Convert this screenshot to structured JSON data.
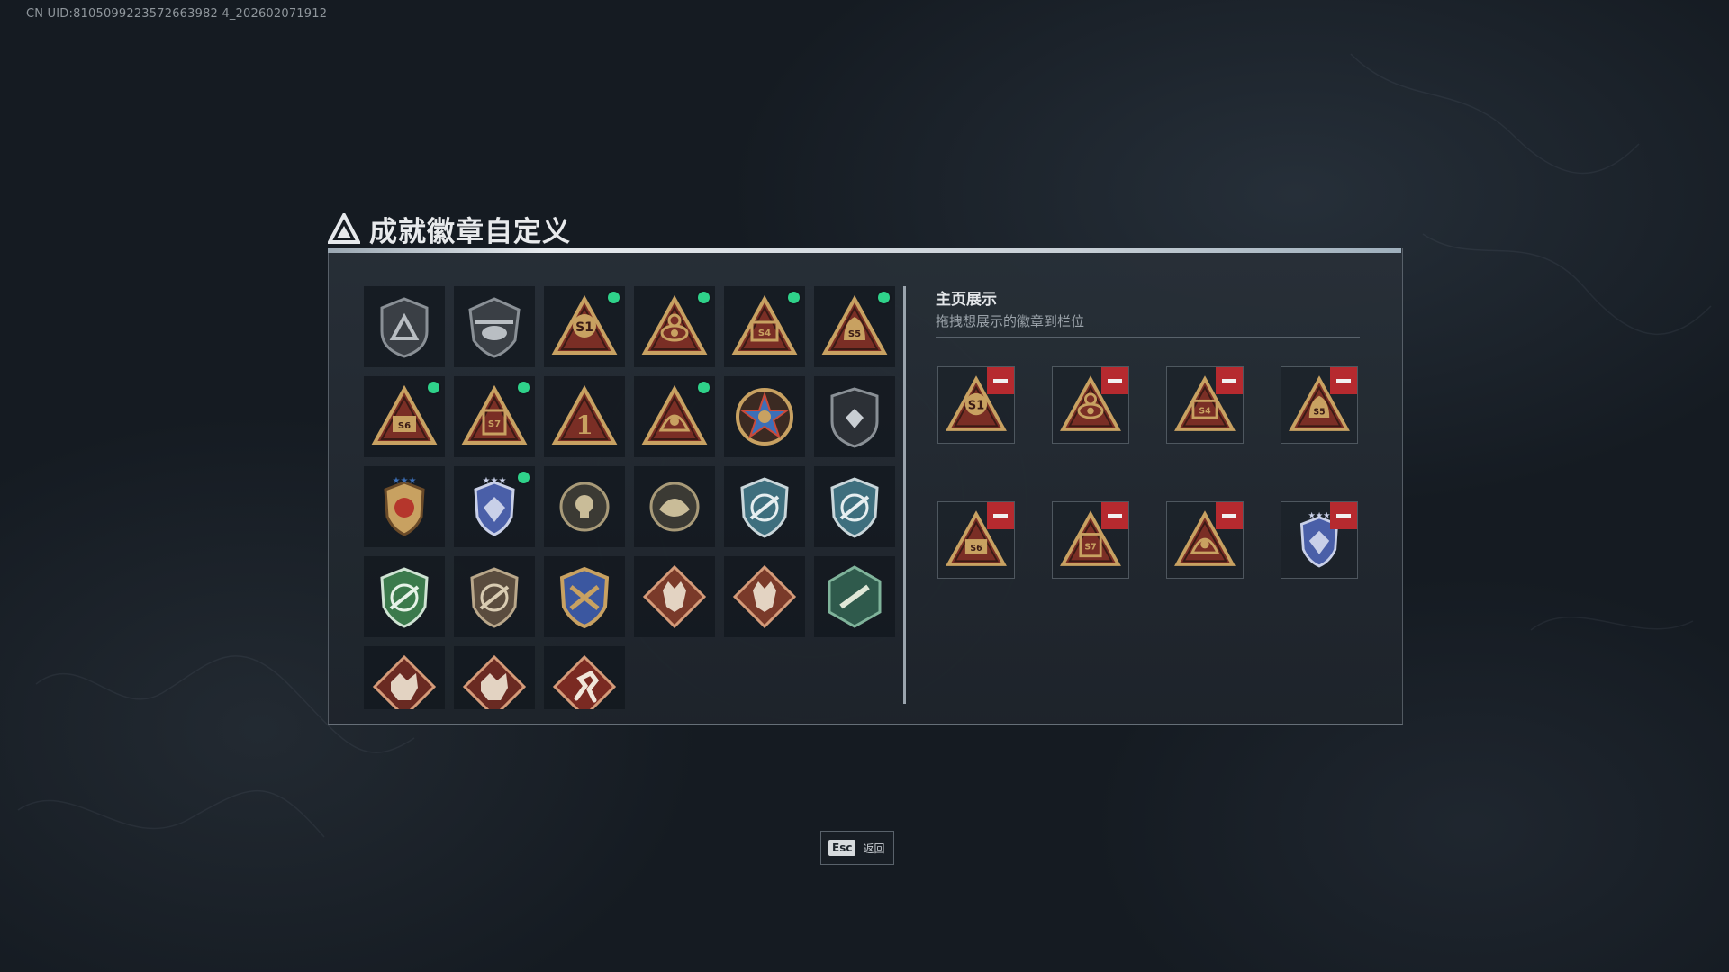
{
  "uid_text": "CN UID:8105099223572663982 4_202602071912",
  "panel": {
    "title": "成就徽章自定义"
  },
  "badges": [
    {
      "id": "b1",
      "kind": "shield-triangle",
      "new": false
    },
    {
      "id": "b2",
      "kind": "helicopter-shield",
      "new": false
    },
    {
      "id": "b3",
      "kind": "triangle-s1",
      "new": true
    },
    {
      "id": "b4",
      "kind": "triangle-eye",
      "new": true
    },
    {
      "id": "b5",
      "kind": "triangle-s4",
      "new": true
    },
    {
      "id": "b6",
      "kind": "triangle-s5",
      "new": true
    },
    {
      "id": "b7",
      "kind": "triangle-s6",
      "new": true
    },
    {
      "id": "b8",
      "kind": "triangle-s7",
      "new": true
    },
    {
      "id": "b9",
      "kind": "triangle-one",
      "new": false
    },
    {
      "id": "b10",
      "kind": "triangle-crest",
      "new": true
    },
    {
      "id": "b11",
      "kind": "star-medal",
      "new": false
    },
    {
      "id": "b12",
      "kind": "shield-dark",
      "new": false
    },
    {
      "id": "b13",
      "kind": "shield-gold-wings",
      "new": false
    },
    {
      "id": "b14",
      "kind": "shield-blue-wings",
      "new": true
    },
    {
      "id": "b15",
      "kind": "circle-skull",
      "new": false
    },
    {
      "id": "b16",
      "kind": "circle-crest",
      "new": false
    },
    {
      "id": "b17",
      "kind": "shield-blue-rifle",
      "new": false
    },
    {
      "id": "b18",
      "kind": "shield-blue-rifle",
      "new": false
    },
    {
      "id": "b19",
      "kind": "shield-green-rifle",
      "new": false
    },
    {
      "id": "b20",
      "kind": "shield-bronze-rifle",
      "new": false
    },
    {
      "id": "b21",
      "kind": "shield-blue-gold",
      "new": false
    },
    {
      "id": "b22",
      "kind": "diamond-wolf",
      "new": false
    },
    {
      "id": "b23",
      "kind": "diamond-wolf",
      "new": false
    },
    {
      "id": "b24",
      "kind": "hexagon-green",
      "new": false
    },
    {
      "id": "b25",
      "kind": "diamond-dragon",
      "new": false
    },
    {
      "id": "b26",
      "kind": "diamond-dragon",
      "new": false
    },
    {
      "id": "b27",
      "kind": "diamond-runner",
      "new": false
    }
  ],
  "showcase": {
    "title": "主页展示",
    "subtitle": "拖拽想展示的徽章到栏位",
    "slots": [
      {
        "kind": "triangle-s1"
      },
      {
        "kind": "triangle-eye"
      },
      {
        "kind": "triangle-s4"
      },
      {
        "kind": "triangle-s5"
      },
      {
        "kind": "triangle-s6"
      },
      {
        "kind": "triangle-s7"
      },
      {
        "kind": "triangle-crest"
      },
      {
        "kind": "shield-blue-wings"
      }
    ]
  },
  "footer": {
    "esc_key": "Esc",
    "esc_label": "返回"
  },
  "colors": {
    "new_dot": "#2fd28a",
    "remove": "#b62a2f",
    "gold": "#c8a161",
    "red": "#7a2e25"
  }
}
